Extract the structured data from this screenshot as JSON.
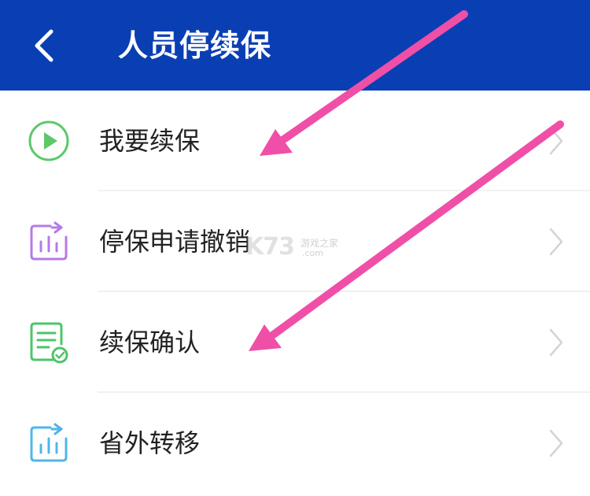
{
  "header": {
    "title": "人员停续保",
    "background": "#0a3fb4"
  },
  "menu": {
    "items": [
      {
        "label": "我要续保",
        "icon": "play-circle-icon",
        "color": "#5cc86a"
      },
      {
        "label": "停保申请撤销",
        "icon": "bar-chart-icon",
        "color": "#b679e8"
      },
      {
        "label": "续保确认",
        "icon": "document-check-icon",
        "color": "#4ec46a"
      },
      {
        "label": "省外转移",
        "icon": "transfer-chart-icon",
        "color": "#4fb6e8"
      }
    ]
  },
  "watermark": {
    "logo": "K73",
    "text": "游戏之家",
    "sub": ".com"
  },
  "annotation": {
    "arrow_color": "#f04fa8"
  }
}
